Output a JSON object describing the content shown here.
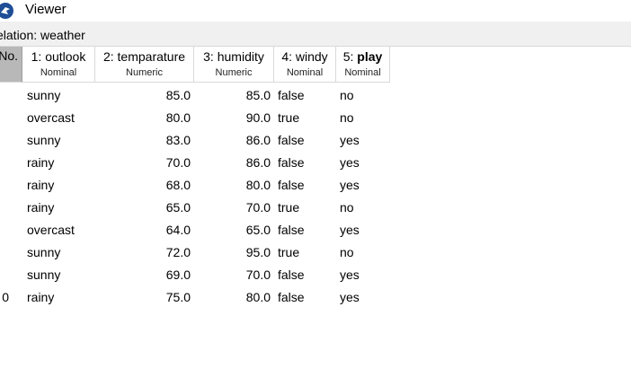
{
  "window": {
    "title": "Viewer"
  },
  "relation": {
    "label": "elation: weather"
  },
  "table": {
    "no_header": "No.",
    "columns": [
      {
        "prefix": "1: ",
        "name": "outlook",
        "type": "Nominal",
        "bold": false
      },
      {
        "prefix": "2: ",
        "name": "temparature",
        "type": "Numeric",
        "bold": false
      },
      {
        "prefix": "3: ",
        "name": "humidity",
        "type": "Numeric",
        "bold": false
      },
      {
        "prefix": "4: ",
        "name": "windy",
        "type": "Nominal",
        "bold": false
      },
      {
        "prefix": "5: ",
        "name": "play",
        "type": "Nominal",
        "bold": true
      }
    ],
    "rows": [
      {
        "no": "",
        "outlook": "sunny",
        "temp": "85.0",
        "hum": "85.0",
        "windy": "false",
        "play": "no"
      },
      {
        "no": "",
        "outlook": "overcast",
        "temp": "80.0",
        "hum": "90.0",
        "windy": "true",
        "play": "no"
      },
      {
        "no": "",
        "outlook": "sunny",
        "temp": "83.0",
        "hum": "86.0",
        "windy": "false",
        "play": "yes"
      },
      {
        "no": "",
        "outlook": "rainy",
        "temp": "70.0",
        "hum": "86.0",
        "windy": "false",
        "play": "yes"
      },
      {
        "no": "",
        "outlook": "rainy",
        "temp": "68.0",
        "hum": "80.0",
        "windy": "false",
        "play": "yes"
      },
      {
        "no": "",
        "outlook": "rainy",
        "temp": "65.0",
        "hum": "70.0",
        "windy": "true",
        "play": "no"
      },
      {
        "no": "",
        "outlook": "overcast",
        "temp": "64.0",
        "hum": "65.0",
        "windy": "false",
        "play": "yes"
      },
      {
        "no": "",
        "outlook": "sunny",
        "temp": "72.0",
        "hum": "95.0",
        "windy": "true",
        "play": "no"
      },
      {
        "no": "",
        "outlook": "sunny",
        "temp": "69.0",
        "hum": "70.0",
        "windy": "false",
        "play": "yes"
      },
      {
        "no": "0",
        "outlook": "rainy",
        "temp": "75.0",
        "hum": "80.0",
        "windy": "false",
        "play": "yes"
      }
    ]
  },
  "colors": {
    "header_no_bg": "#b8b8b8",
    "relation_bar_bg": "#f0f0f0",
    "app_icon_blue": "#1f4e96"
  },
  "icons": {
    "app": "weka-bird-icon"
  }
}
